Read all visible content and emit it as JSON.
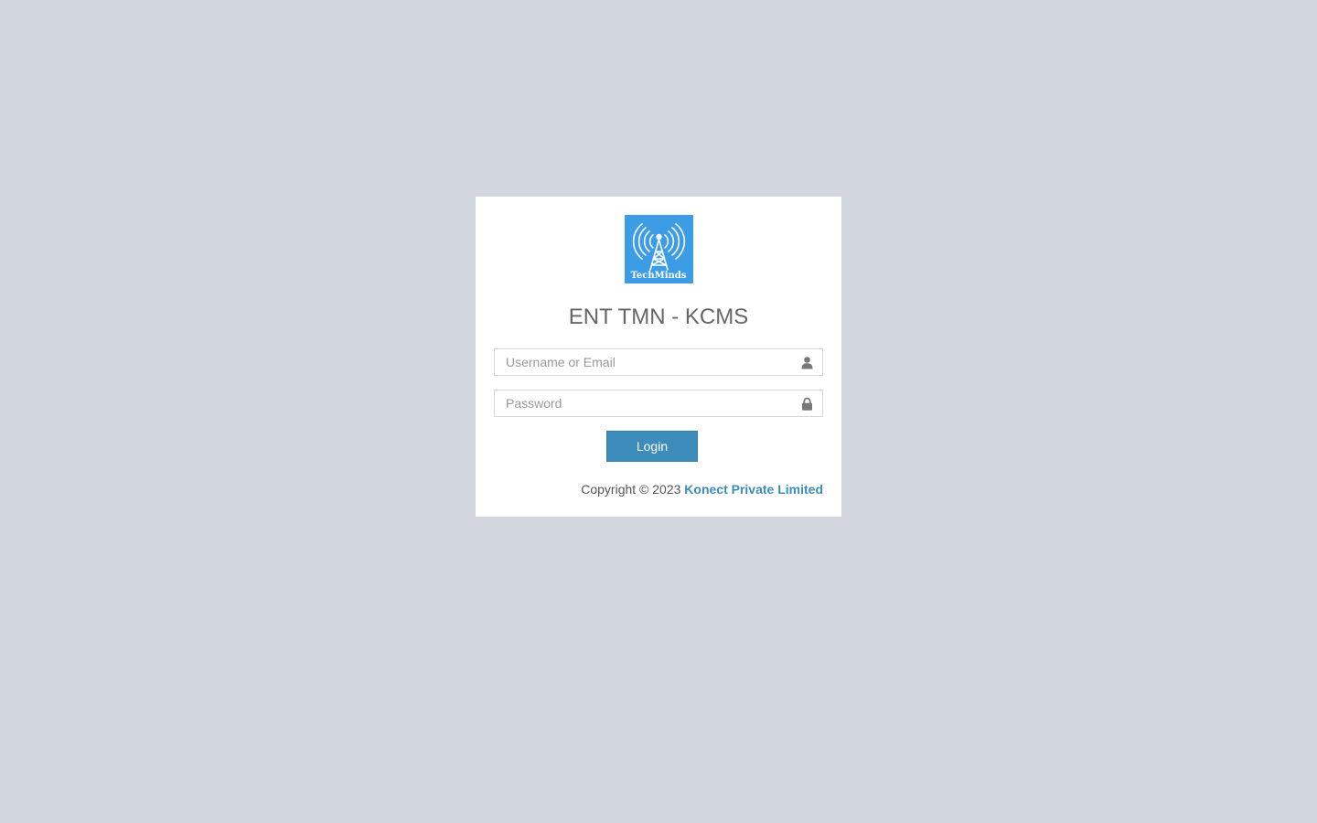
{
  "logo": {
    "alt": "TechMinds logo",
    "text": "TechMinds",
    "icon": "radio-tower-icon",
    "background": "#3c9de6"
  },
  "app_title": "ENT TMN - KCMS",
  "form": {
    "username_placeholder": "Username or Email",
    "username_value": "",
    "username_icon": "user-icon",
    "password_placeholder": "Password",
    "password_value": "",
    "password_icon": "lock-icon",
    "login_label": "Login"
  },
  "footer": {
    "copyright_prefix": "Copyright © 2023",
    "company_link": "Konect Private Limited"
  },
  "colors": {
    "page_background": "#d2d6de",
    "accent": "#3c8dbc"
  }
}
